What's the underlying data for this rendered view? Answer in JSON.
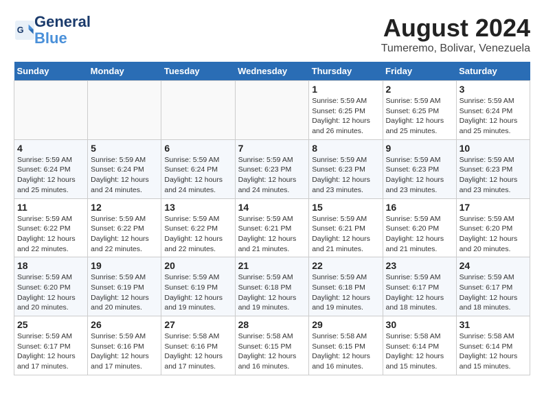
{
  "header": {
    "logo_line1": "General",
    "logo_line2": "Blue",
    "month_year": "August 2024",
    "location": "Tumeremo, Bolivar, Venezuela"
  },
  "weekdays": [
    "Sunday",
    "Monday",
    "Tuesday",
    "Wednesday",
    "Thursday",
    "Friday",
    "Saturday"
  ],
  "weeks": [
    [
      {
        "day": "",
        "info": ""
      },
      {
        "day": "",
        "info": ""
      },
      {
        "day": "",
        "info": ""
      },
      {
        "day": "",
        "info": ""
      },
      {
        "day": "1",
        "info": "Sunrise: 5:59 AM\nSunset: 6:25 PM\nDaylight: 12 hours\nand 26 minutes."
      },
      {
        "day": "2",
        "info": "Sunrise: 5:59 AM\nSunset: 6:25 PM\nDaylight: 12 hours\nand 25 minutes."
      },
      {
        "day": "3",
        "info": "Sunrise: 5:59 AM\nSunset: 6:24 PM\nDaylight: 12 hours\nand 25 minutes."
      }
    ],
    [
      {
        "day": "4",
        "info": "Sunrise: 5:59 AM\nSunset: 6:24 PM\nDaylight: 12 hours\nand 25 minutes."
      },
      {
        "day": "5",
        "info": "Sunrise: 5:59 AM\nSunset: 6:24 PM\nDaylight: 12 hours\nand 24 minutes."
      },
      {
        "day": "6",
        "info": "Sunrise: 5:59 AM\nSunset: 6:24 PM\nDaylight: 12 hours\nand 24 minutes."
      },
      {
        "day": "7",
        "info": "Sunrise: 5:59 AM\nSunset: 6:23 PM\nDaylight: 12 hours\nand 24 minutes."
      },
      {
        "day": "8",
        "info": "Sunrise: 5:59 AM\nSunset: 6:23 PM\nDaylight: 12 hours\nand 23 minutes."
      },
      {
        "day": "9",
        "info": "Sunrise: 5:59 AM\nSunset: 6:23 PM\nDaylight: 12 hours\nand 23 minutes."
      },
      {
        "day": "10",
        "info": "Sunrise: 5:59 AM\nSunset: 6:23 PM\nDaylight: 12 hours\nand 23 minutes."
      }
    ],
    [
      {
        "day": "11",
        "info": "Sunrise: 5:59 AM\nSunset: 6:22 PM\nDaylight: 12 hours\nand 22 minutes."
      },
      {
        "day": "12",
        "info": "Sunrise: 5:59 AM\nSunset: 6:22 PM\nDaylight: 12 hours\nand 22 minutes."
      },
      {
        "day": "13",
        "info": "Sunrise: 5:59 AM\nSunset: 6:22 PM\nDaylight: 12 hours\nand 22 minutes."
      },
      {
        "day": "14",
        "info": "Sunrise: 5:59 AM\nSunset: 6:21 PM\nDaylight: 12 hours\nand 21 minutes."
      },
      {
        "day": "15",
        "info": "Sunrise: 5:59 AM\nSunset: 6:21 PM\nDaylight: 12 hours\nand 21 minutes."
      },
      {
        "day": "16",
        "info": "Sunrise: 5:59 AM\nSunset: 6:20 PM\nDaylight: 12 hours\nand 21 minutes."
      },
      {
        "day": "17",
        "info": "Sunrise: 5:59 AM\nSunset: 6:20 PM\nDaylight: 12 hours\nand 20 minutes."
      }
    ],
    [
      {
        "day": "18",
        "info": "Sunrise: 5:59 AM\nSunset: 6:20 PM\nDaylight: 12 hours\nand 20 minutes."
      },
      {
        "day": "19",
        "info": "Sunrise: 5:59 AM\nSunset: 6:19 PM\nDaylight: 12 hours\nand 20 minutes."
      },
      {
        "day": "20",
        "info": "Sunrise: 5:59 AM\nSunset: 6:19 PM\nDaylight: 12 hours\nand 19 minutes."
      },
      {
        "day": "21",
        "info": "Sunrise: 5:59 AM\nSunset: 6:18 PM\nDaylight: 12 hours\nand 19 minutes."
      },
      {
        "day": "22",
        "info": "Sunrise: 5:59 AM\nSunset: 6:18 PM\nDaylight: 12 hours\nand 19 minutes."
      },
      {
        "day": "23",
        "info": "Sunrise: 5:59 AM\nSunset: 6:17 PM\nDaylight: 12 hours\nand 18 minutes."
      },
      {
        "day": "24",
        "info": "Sunrise: 5:59 AM\nSunset: 6:17 PM\nDaylight: 12 hours\nand 18 minutes."
      }
    ],
    [
      {
        "day": "25",
        "info": "Sunrise: 5:59 AM\nSunset: 6:17 PM\nDaylight: 12 hours\nand 17 minutes."
      },
      {
        "day": "26",
        "info": "Sunrise: 5:59 AM\nSunset: 6:16 PM\nDaylight: 12 hours\nand 17 minutes."
      },
      {
        "day": "27",
        "info": "Sunrise: 5:58 AM\nSunset: 6:16 PM\nDaylight: 12 hours\nand 17 minutes."
      },
      {
        "day": "28",
        "info": "Sunrise: 5:58 AM\nSunset: 6:15 PM\nDaylight: 12 hours\nand 16 minutes."
      },
      {
        "day": "29",
        "info": "Sunrise: 5:58 AM\nSunset: 6:15 PM\nDaylight: 12 hours\nand 16 minutes."
      },
      {
        "day": "30",
        "info": "Sunrise: 5:58 AM\nSunset: 6:14 PM\nDaylight: 12 hours\nand 15 minutes."
      },
      {
        "day": "31",
        "info": "Sunrise: 5:58 AM\nSunset: 6:14 PM\nDaylight: 12 hours\nand 15 minutes."
      }
    ]
  ]
}
